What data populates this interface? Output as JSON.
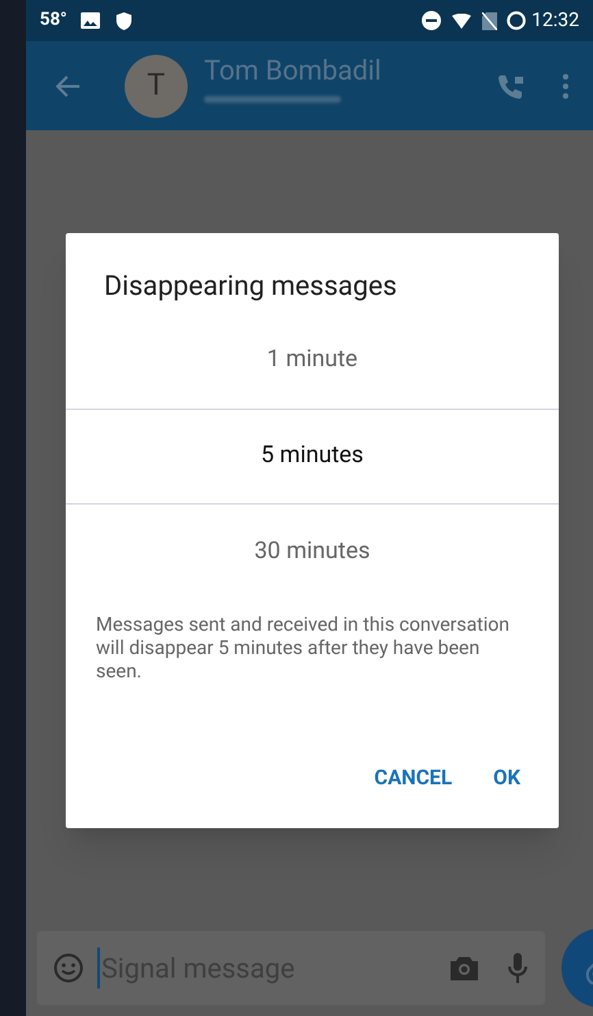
{
  "status_bar": {
    "temperature": "58°",
    "time": "12:32"
  },
  "app_bar": {
    "avatar_letter": "T",
    "contact_name": "Tom Bombadil"
  },
  "dialog": {
    "title": "Disappearing messages",
    "options": [
      {
        "label": "1 minute",
        "selected": false
      },
      {
        "label": "5 minutes",
        "selected": true
      },
      {
        "label": "30 minutes",
        "selected": false
      }
    ],
    "description": "Messages sent and received in this conversation will disappear 5 minutes after they have been seen.",
    "buttons": [
      "CANCEL",
      "OK"
    ]
  },
  "composer": {
    "placeholder": "Signal message"
  }
}
